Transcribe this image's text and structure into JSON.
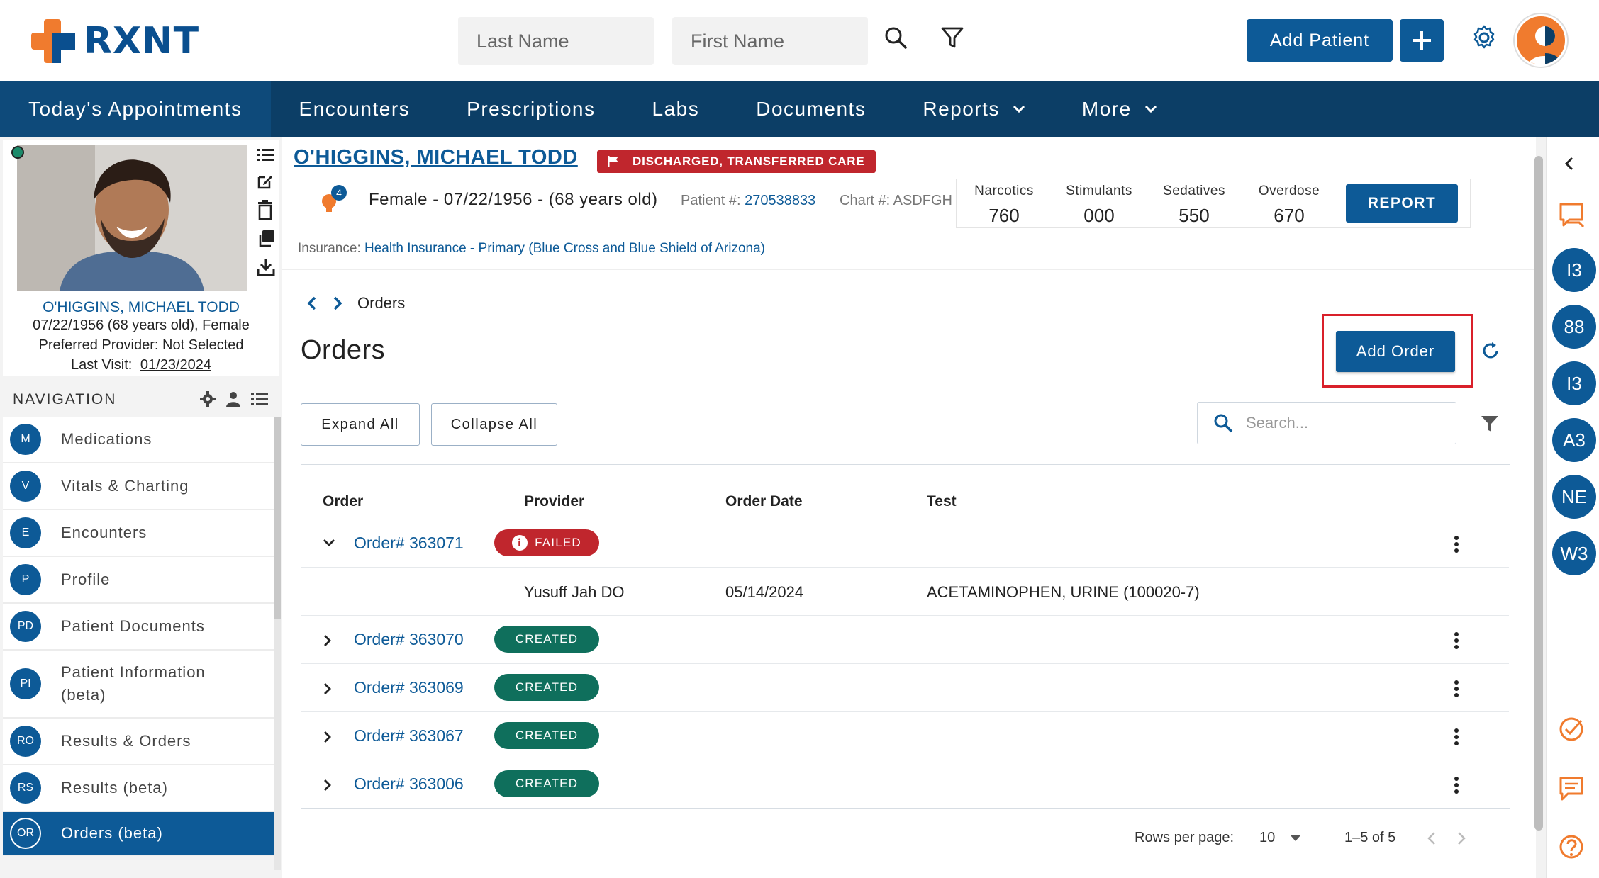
{
  "brand": {
    "name": "RXNT"
  },
  "header": {
    "last_name_placeholder": "Last Name",
    "first_name_placeholder": "First Name",
    "add_patient_label": "Add Patient"
  },
  "topnav": {
    "items": [
      {
        "label": "Today's Appointments"
      },
      {
        "label": "Encounters"
      },
      {
        "label": "Prescriptions"
      },
      {
        "label": "Labs"
      },
      {
        "label": "Documents"
      },
      {
        "label": "Reports"
      },
      {
        "label": "More"
      }
    ]
  },
  "patient_card": {
    "name": "O'HIGGINS, MICHAEL TODD",
    "dob_line": "07/22/1956 (68 years old), Female",
    "provider_line": "Preferred Provider: Not Selected",
    "last_visit_label": "Last Visit:",
    "last_visit_date": "01/23/2024"
  },
  "navigation": {
    "title": "NAVIGATION",
    "items": [
      {
        "badge": "M",
        "label": "Medications"
      },
      {
        "badge": "V",
        "label": "Vitals & Charting"
      },
      {
        "badge": "E",
        "label": "Encounters"
      },
      {
        "badge": "P",
        "label": "Profile"
      },
      {
        "badge": "PD",
        "label": "Patient Documents"
      },
      {
        "badge": "PI",
        "label": "Patient Information (beta)"
      },
      {
        "badge": "RO",
        "label": "Results & Orders"
      },
      {
        "badge": "RS",
        "label": "Results (beta)"
      },
      {
        "badge": "OR",
        "label": "Orders (beta)"
      }
    ]
  },
  "patient_header": {
    "name": "O'HIGGINS, MICHAEL TODD",
    "status_badge": "DISCHARGED, TRANSFERRED CARE",
    "alert_count": "4",
    "demographics": "Female - 07/22/1956 - (68 years old)",
    "patient_num_label": "Patient #:",
    "patient_num": "270538833",
    "chart_label": "Chart #:",
    "chart_num": "ASDFGH",
    "insurance_label": "Insurance:",
    "insurance_value": "Health Insurance - Primary (Blue Cross and Blue Shield of Arizona)",
    "pdmp": [
      {
        "label": "Narcotics",
        "value": "760"
      },
      {
        "label": "Stimulants",
        "value": "000"
      },
      {
        "label": "Sedatives",
        "value": "550"
      },
      {
        "label": "Overdose",
        "value": "670"
      }
    ],
    "report_label": "REPORT"
  },
  "orders_page": {
    "breadcrumb": "Orders",
    "title": "Orders",
    "add_order_label": "Add Order",
    "expand_all": "Expand All",
    "collapse_all": "Collapse All",
    "search_placeholder": "Search...",
    "columns": [
      "Order",
      "Provider",
      "Order Date",
      "Test"
    ],
    "rows": [
      {
        "order": "Order# 363071",
        "status": "FAILED",
        "expanded": true
      },
      {
        "order": "Order# 363070",
        "status": "CREATED",
        "expanded": false
      },
      {
        "order": "Order# 363069",
        "status": "CREATED",
        "expanded": false
      },
      {
        "order": "Order# 363067",
        "status": "CREATED",
        "expanded": false
      },
      {
        "order": "Order# 363006",
        "status": "CREATED",
        "expanded": false
      }
    ],
    "expanded_detail": {
      "provider": "Yusuff Jah DO",
      "order_date": "05/14/2024",
      "test": "ACETAMINOPHEN, URINE (100020-7)"
    },
    "pagination": {
      "rows_per_page_label": "Rows per page:",
      "rows_per_page_value": "10",
      "range": "1–5 of 5"
    }
  },
  "right_rail": {
    "circles": [
      "I3",
      "88",
      "I3",
      "A3",
      "NE",
      "W3"
    ]
  },
  "colors": {
    "primary": "#0d5a97",
    "nav_bg": "#0c3e66",
    "danger": "#c0262d",
    "success": "#0f6f5c",
    "brand_orange": "#f07b2e"
  }
}
